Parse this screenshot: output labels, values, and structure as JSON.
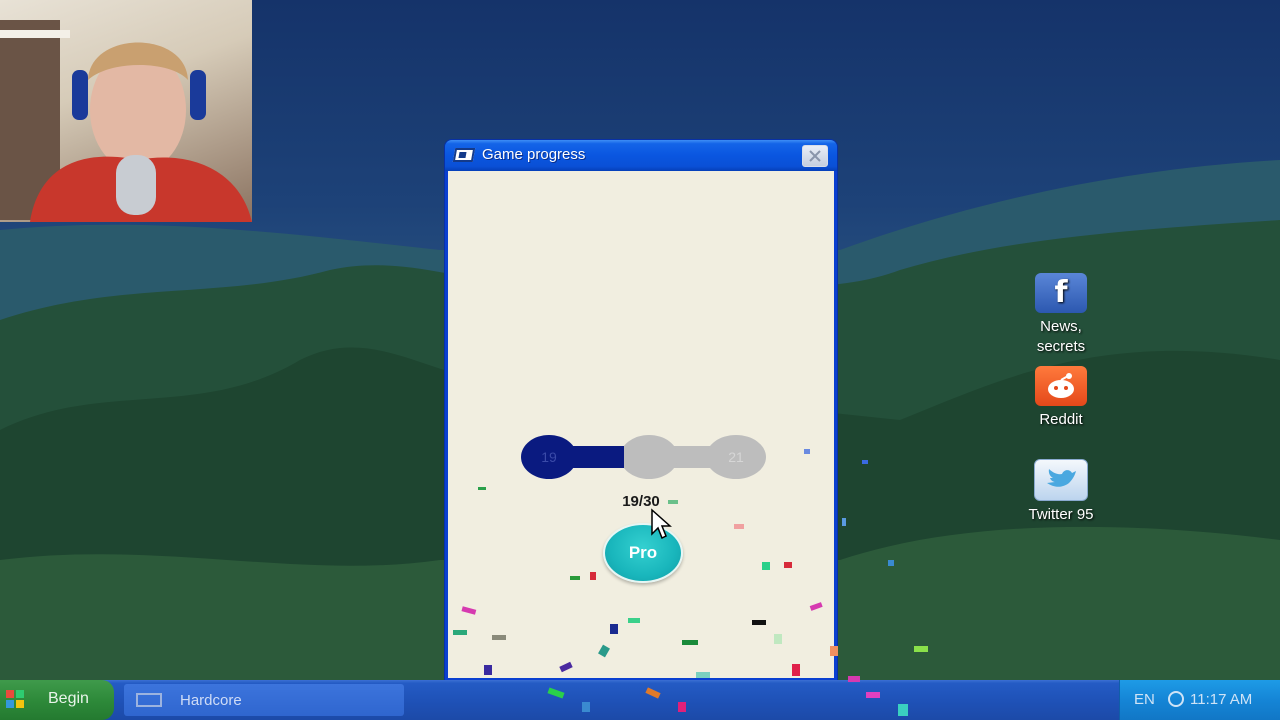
{
  "window": {
    "title": "Game progress",
    "current_level": "19",
    "next_level": "21",
    "progress_text": "19/30",
    "progress_fraction": 0.4,
    "pro_button_label": "Pro"
  },
  "desktop_icons": [
    {
      "label_line1": "News,",
      "label_line2": "secrets",
      "icon": "facebook-icon"
    },
    {
      "label_line1": "Reddit",
      "label_line2": "",
      "icon": "reddit-icon"
    },
    {
      "label_line1": "Twitter 95",
      "label_line2": "",
      "icon": "twitter-bird-icon"
    }
  ],
  "taskbar": {
    "start_label": "Begin",
    "task_label": "Hardcore",
    "language": "EN",
    "clock": "11:17 AM"
  },
  "colors": {
    "progress_fill": "#0a1a80",
    "progress_empty": "#bdbdbd",
    "pro_button": "#19b6bc",
    "window_bg": "#f1eee0"
  }
}
